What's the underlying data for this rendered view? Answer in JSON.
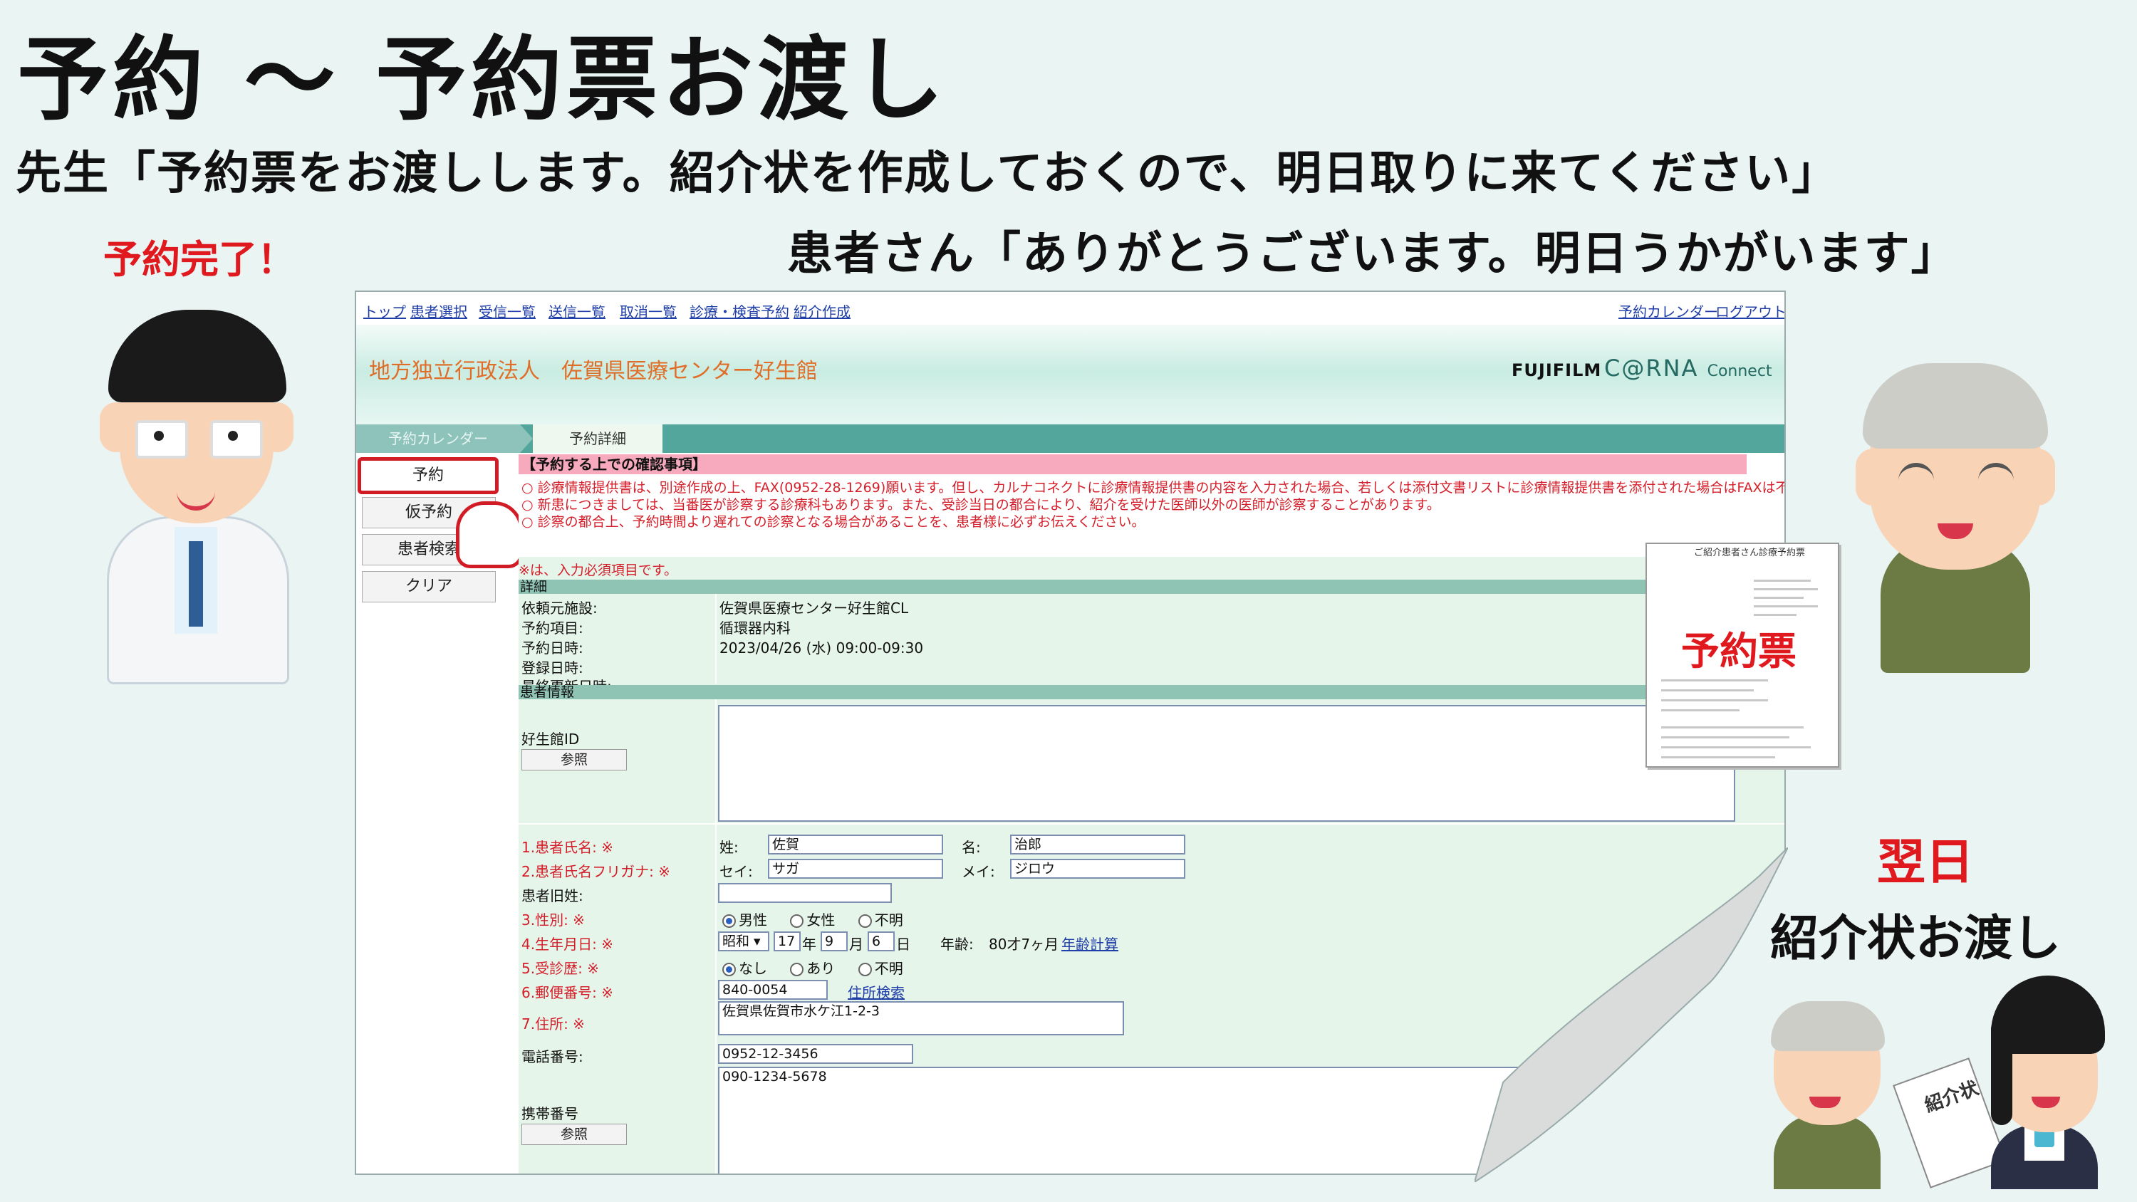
{
  "slide": {
    "title": "予約 ～ 予約票お渡し",
    "doctor_line": "先生「予約票をお渡しします。紹介状を作成しておくので、明日取りに来てください」",
    "patient_line": "患者さん「ありがとうございます。明日うかがいます」",
    "done_label": "予約完了！",
    "next_day": "翌日",
    "handover": "紹介状お渡し",
    "slip_heading": "ご紹介患者さん診療予約票",
    "slip_label": "予約票",
    "referral_label": "紹介状"
  },
  "nav": {
    "left": [
      "トップ",
      "患者選択",
      "受信一覧",
      "送信一覧",
      "取消一覧",
      "診療・検査予約",
      "紹介作成"
    ],
    "right": [
      "予約カレンダー",
      "ログアウト"
    ]
  },
  "banner": {
    "org": "地方独立行政法人　佐賀県医療センター好生館",
    "brand1": "FUJIFILM",
    "brand2": "C@RNA",
    "brand3": "Connect"
  },
  "tabs": {
    "calendar": "予約カレンダー",
    "detail": "予約詳細"
  },
  "sidebar": {
    "reserve": "予約",
    "tentative": "仮予約",
    "patient_search": "患者検索",
    "clear": "クリア"
  },
  "notice": {
    "title": "【予約する上での確認事項】",
    "lines": [
      "○ 診療情報提供書は、別途作成の上、FAX(0952-28-1269)願います。但し、カルナコネクトに診療情報提供書の内容を入力された場合、若しくは添付文書リストに診療情報提供書を添付された場合はFAXは不要です。",
      "○ 新患につきましては、当番医が診察する診療科もあります。また、受診当日の都合により、紹介を受けた医師以外の医師が診察することがあります。",
      "○ 診察の都合上、予約時間より遅れての診察となる場合があることを、患者様に必ずお伝えください。"
    ],
    "required": "※は、入力必須項目です。"
  },
  "detail": {
    "section": "詳細",
    "rows": [
      {
        "label": "依頼元施設:",
        "value": "佐賀県医療センター好生館CL"
      },
      {
        "label": "予約項目:",
        "value": "循環器内科"
      },
      {
        "label": "予約日時:",
        "value": "2023/04/26 (水) 09:00-09:30"
      },
      {
        "label": "登録日時:",
        "value": ""
      },
      {
        "label": "最終更新日時:",
        "value": ""
      }
    ]
  },
  "patient": {
    "section": "患者情報",
    "koseikan_id_label": "好生館ID",
    "ref_button": "参照",
    "name_label": "1.患者氏名: ※",
    "last_label": "姓:",
    "last_value": "佐賀",
    "first_label": "名:",
    "first_value": "治郎",
    "kana_label": "2.患者氏名フリガナ: ※",
    "sei_label": "セイ:",
    "sei_value": "サガ",
    "mei_label": "メイ:",
    "mei_value": "ジロウ",
    "old_last_label": "患者旧姓:",
    "sex_label": "3.性別: ※",
    "sex_options": [
      "男性",
      "女性",
      "不明"
    ],
    "birth_label": "4.生年月日: ※",
    "era": "昭和",
    "year": "17",
    "year_unit": "年",
    "month": "9",
    "month_unit": "月",
    "day": "6",
    "day_unit": "日",
    "age_label": "年齢:",
    "age_value": "80才7ヶ月",
    "age_calc_link": "年齢計算",
    "visit_label": "5.受診歴: ※",
    "visit_options": [
      "なし",
      "あり",
      "不明"
    ],
    "zip_label": "6.郵便番号: ※",
    "zip_value": "840-0054",
    "address_search_link": "住所検索",
    "address_label": "7.住所: ※",
    "address_value": "佐賀県佐賀市水ケ江1-2-3",
    "phone_label": "電話番号:",
    "phone_value": "0952-12-3456",
    "mobile_label": "携帯番号",
    "mobile_value": "090-1234-5678"
  },
  "colors": {
    "accent_red": "#e0191f",
    "teal": "#53a69c",
    "link_blue": "#1f3ea8",
    "notice_pink": "#f7a9bd"
  }
}
